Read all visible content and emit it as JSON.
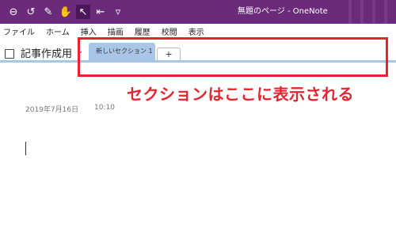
{
  "titlebar": {
    "title": "無題のページ - OneNote",
    "bg": "#6b2a7a",
    "quick_access": [
      {
        "icon": "back-icon",
        "glyph": "⊖"
      },
      {
        "icon": "undo-icon",
        "glyph": "↺"
      },
      {
        "icon": "pen-icon",
        "glyph": "✎"
      },
      {
        "icon": "hand-icon",
        "glyph": "✋"
      },
      {
        "icon": "touch-mode-icon",
        "glyph": "↖"
      },
      {
        "icon": "dock-icon",
        "glyph": "⇤"
      },
      {
        "icon": "customize-icon",
        "glyph": "▿"
      }
    ]
  },
  "menu": {
    "items": [
      "ファイル",
      "ホーム",
      "挿入",
      "描画",
      "履歴",
      "校閲",
      "表示"
    ]
  },
  "notebook": {
    "title": "記事作成用",
    "sections": [
      "新しいセクション 1"
    ],
    "add_tab_label": "+"
  },
  "annotation": {
    "text": "セクションはここに表示される",
    "color": "#e8222e"
  },
  "page": {
    "date": "2019年7月16日",
    "time": "10:10"
  }
}
